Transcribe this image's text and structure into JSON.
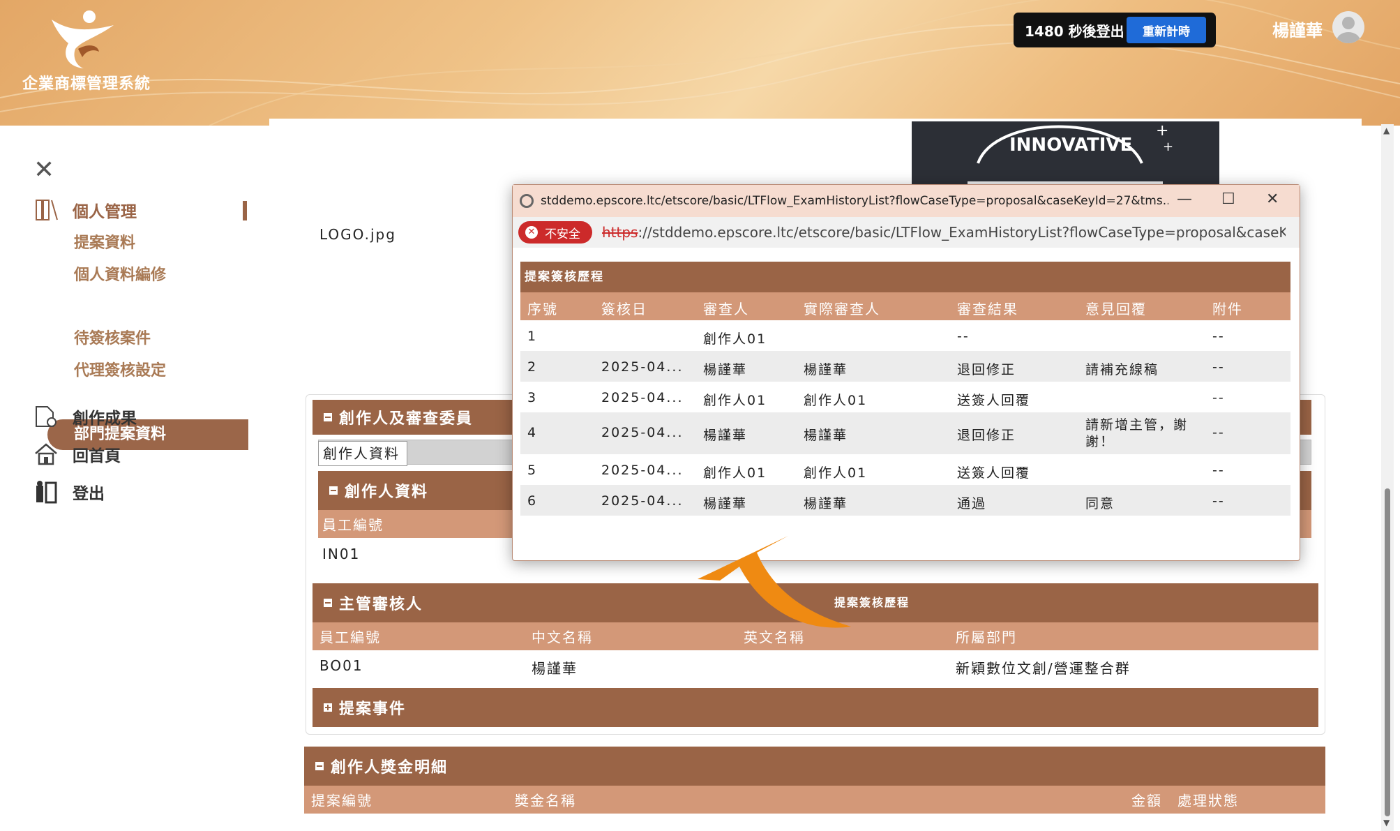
{
  "header": {
    "system_name": "企業商標管理系統",
    "timer_text": "1480 秒後登出",
    "reset_label": "重新計時",
    "user_name": "楊謹華"
  },
  "sidebar": {
    "close_icon": "close-icon",
    "groups": [
      {
        "label": "個人管理",
        "icon": "document-icon"
      },
      {
        "label": "創作成果",
        "icon": "file-icon"
      },
      {
        "label": "回首頁",
        "icon": "home-icon"
      },
      {
        "label": "登出",
        "icon": "logout-icon"
      }
    ],
    "sub_items": [
      "提案資料",
      "個人資料編修",
      "部門提案資料",
      "待簽核案件",
      "代理簽核設定"
    ],
    "active_sub": "部門提案資料"
  },
  "main": {
    "logo_file": "LOGO.jpg",
    "logo_preview_text": "INNOVATIVE",
    "creator_section_title": "創作人及審查委員",
    "creator_tab": "創作人資料",
    "creator_subsection": "創作人資料",
    "creator_columns": [
      "員工編號"
    ],
    "creator_rows": [
      [
        "IN01"
      ]
    ],
    "manager_section_title": "主管審核人",
    "manager_columns": [
      "員工編號",
      "中文名稱",
      "英文名稱",
      "所屬部門"
    ],
    "manager_row": [
      "BO01",
      "楊謹華",
      "",
      "新穎數位文創/營運整合群"
    ],
    "event_section_title": "提案事件",
    "bonus_section_title": "創作人獎金明細",
    "bonus_columns": [
      "提案編號",
      "獎金名稱",
      "金額",
      "處理狀態"
    ]
  },
  "popup": {
    "title": "stddemo.epscore.ltc/etscore/basic/LTFlow_ExamHistoryList?flowCaseType=proposal&caseKeyId=27&tms...",
    "insecure_label": "不安全",
    "url_scheme": "https",
    "url_rest": "://stddemo.epscore.ltc/etscore/basic/LTFlow_ExamHistoryList?flowCaseType=proposal&caseK...",
    "section_title": "提案簽核歷程",
    "columns": [
      "序號",
      "簽核日",
      "審查人",
      "實際審查人",
      "審查結果",
      "意見回覆",
      "附件"
    ],
    "rows": [
      [
        "1",
        "",
        "創作人01",
        "",
        "--",
        "",
        "--"
      ],
      [
        "2",
        "2025-04...",
        "楊謹華",
        "楊謹華",
        "退回修正",
        "請補充線稿",
        "--"
      ],
      [
        "3",
        "2025-04...",
        "創作人01",
        "創作人01",
        "送簽人回覆",
        "",
        "--"
      ],
      [
        "4",
        "2025-04...",
        "楊謹華",
        "楊謹華",
        "退回修正",
        "請新增主管，謝謝！",
        "--"
      ],
      [
        "5",
        "2025-04...",
        "創作人01",
        "創作人01",
        "送簽人回覆",
        "",
        "--"
      ],
      [
        "6",
        "2025-04...",
        "楊謹華",
        "楊謹華",
        "通過",
        "同意",
        "--"
      ]
    ]
  },
  "arrow_caption": "提案簽核歷程",
  "colors": {
    "brand_brown": "#9a6446",
    "header_light_brown": "#d39878",
    "header_orange": "#e8b075",
    "annotation_orange": "#ef8a12",
    "reset_blue": "#1f6bd8",
    "insecure_red": "#cc2a2a"
  }
}
